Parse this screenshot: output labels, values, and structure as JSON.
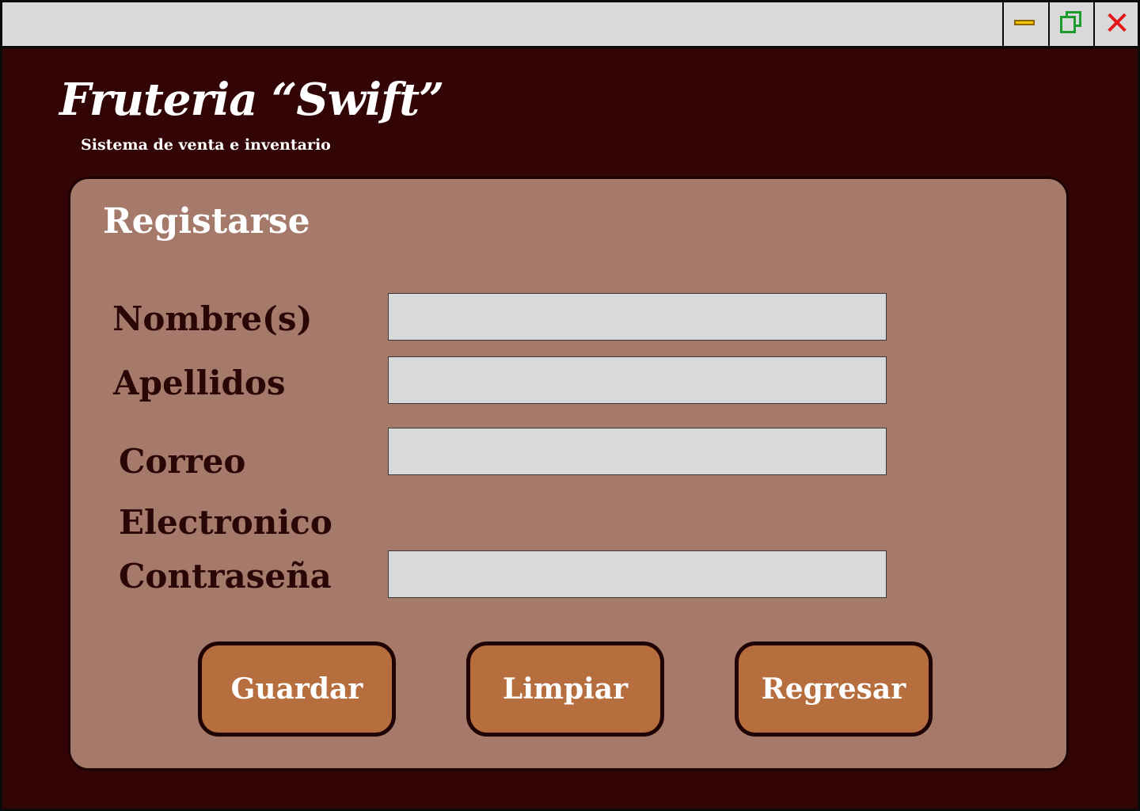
{
  "window": {
    "controls": {
      "minimize_icon": "minimize-icon",
      "maximize_icon": "maximize-icon",
      "close_icon": "close-icon",
      "close_glyph": "✕"
    },
    "colors": {
      "background": "#320405",
      "titlebar": "#d9d9d9",
      "minimize": "#f2c300",
      "maximize": "#1e9b2d",
      "close": "#e31717"
    }
  },
  "header": {
    "title": "Fruteria “Swift”",
    "subtitle": "Sistema de venta e inventario"
  },
  "form": {
    "title": "Registarse",
    "panel_color": "#a57a6a",
    "fields": {
      "nombre": {
        "label": "Nombre(s)",
        "value": "",
        "placeholder": ""
      },
      "apellidos": {
        "label": "Apellidos",
        "value": "",
        "placeholder": ""
      },
      "correo": {
        "label_line1": "Correo",
        "label_line2": "Electronico",
        "value": "",
        "placeholder": ""
      },
      "contrasena": {
        "label": "Contraseña",
        "value": "",
        "placeholder": ""
      }
    },
    "buttons": {
      "guardar": "Guardar",
      "limpiar": "Limpiar",
      "regresar": "Regresar",
      "color": "#b66e3f"
    }
  }
}
